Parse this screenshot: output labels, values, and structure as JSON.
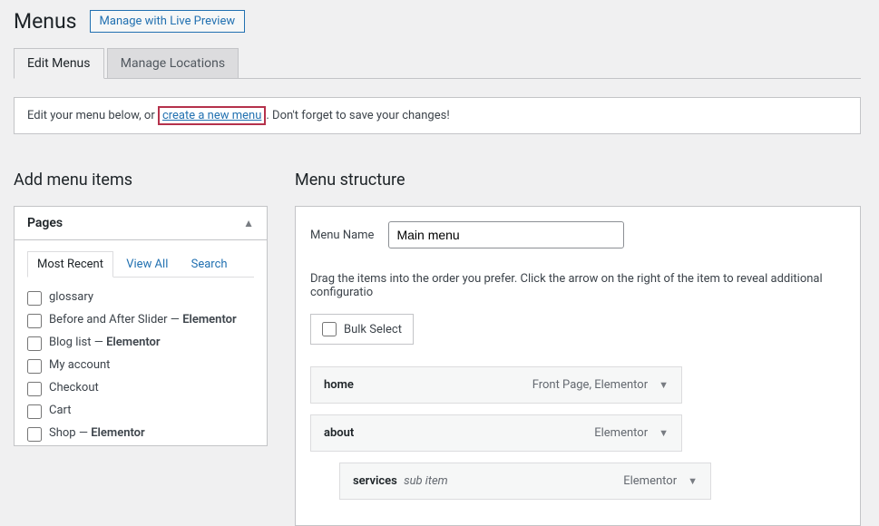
{
  "header": {
    "title": "Menus",
    "preview_button": "Manage with Live Preview"
  },
  "tabs": {
    "edit": "Edit Menus",
    "locations": "Manage Locations"
  },
  "notice": {
    "prefix": "Edit your menu below, or ",
    "link": "create a new menu",
    "suffix": ". Don't forget to save your changes!"
  },
  "left": {
    "heading": "Add menu items",
    "postbox_title": "Pages",
    "sub_tabs": {
      "recent": "Most Recent",
      "view_all": "View All",
      "search": "Search"
    },
    "pages": [
      {
        "label": "glossary"
      },
      {
        "label_pre": "Before and After Slider — ",
        "label_strong": "Elementor"
      },
      {
        "label_pre": "Blog list — ",
        "label_strong": "Elementor"
      },
      {
        "label": "My account"
      },
      {
        "label": "Checkout"
      },
      {
        "label": "Cart"
      },
      {
        "label_pre": "Shop — ",
        "label_strong": "Elementor"
      }
    ]
  },
  "right": {
    "heading": "Menu structure",
    "menu_name_label": "Menu Name",
    "menu_name_value": "Main menu",
    "drag_hint": "Drag the items into the order you prefer. Click the arrow on the right of the item to reveal additional configuratio",
    "bulk_select": "Bulk Select",
    "items": [
      {
        "title": "home",
        "type": "Front Page, Elementor",
        "indent": 0
      },
      {
        "title": "about",
        "type": "Elementor",
        "indent": 0
      },
      {
        "title": "services",
        "subtitle": "sub item",
        "type": "Elementor",
        "indent": 1
      }
    ]
  }
}
